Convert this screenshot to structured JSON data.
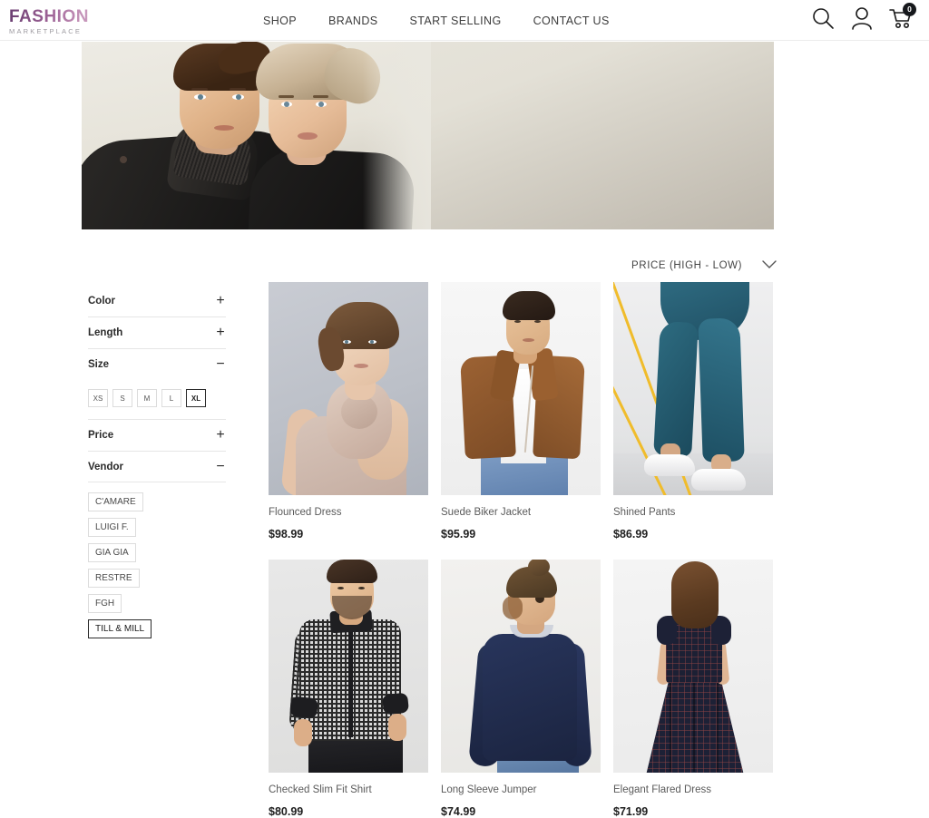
{
  "header": {
    "logo": {
      "main": "FASHION",
      "sub": "MARKETPLACE"
    },
    "nav": [
      {
        "label": "SHOP"
      },
      {
        "label": "BRANDS"
      },
      {
        "label": "START SELLING"
      },
      {
        "label": "CONTACT US"
      }
    ],
    "icons": {
      "search": "search-icon",
      "account": "user-icon",
      "cart": "cart-icon"
    },
    "cart_count": "0"
  },
  "hero": {
    "alt": "Two fashion models in black knitwear on beige backdrop"
  },
  "sort": {
    "label": "PRICE (HIGH - LOW)",
    "caret": "chevron-down-icon"
  },
  "filters": [
    {
      "id": "color",
      "title": "Color",
      "sign": "+",
      "expanded": false
    },
    {
      "id": "length",
      "title": "Length",
      "sign": "+",
      "expanded": false
    },
    {
      "id": "size",
      "title": "Size",
      "sign": "−",
      "expanded": true
    },
    {
      "id": "price",
      "title": "Price",
      "sign": "+",
      "expanded": false
    },
    {
      "id": "vendor",
      "title": "Vendor",
      "sign": "−",
      "expanded": true
    }
  ],
  "sizes": [
    {
      "label": "XS",
      "selected": false
    },
    {
      "label": "S",
      "selected": false
    },
    {
      "label": "M",
      "selected": false
    },
    {
      "label": "L",
      "selected": false
    },
    {
      "label": "XL",
      "selected": true
    }
  ],
  "vendors": [
    {
      "label": "C'AMARE",
      "selected": false
    },
    {
      "label": "LUIGI F.",
      "selected": false
    },
    {
      "label": "GIA GIA",
      "selected": false
    },
    {
      "label": "RESTRE",
      "selected": false
    },
    {
      "label": "FGH",
      "selected": false
    },
    {
      "label": "TILL & MILL",
      "selected": true
    }
  ],
  "products": [
    {
      "title": "Flounced Dress",
      "price": "$98.99",
      "art": "p1"
    },
    {
      "title": "Suede Biker Jacket",
      "price": "$95.99",
      "art": "p2"
    },
    {
      "title": "Shined Pants",
      "price": "$86.99",
      "art": "p3"
    },
    {
      "title": "Checked Slim Fit Shirt",
      "price": "$80.99",
      "art": "p4"
    },
    {
      "title": "Long Sleeve Jumper",
      "price": "$74.99",
      "art": "p5"
    },
    {
      "title": "Elegant Flared Dress",
      "price": "$71.99",
      "art": "p6"
    }
  ],
  "colors": {
    "logo_dark": "#6b3f72",
    "logo_light": "#d9b3cd",
    "text": "#3c3c3c",
    "muted": "#5a5a5a",
    "border": "#dcdcdc",
    "selected_border": "#2b2b2b",
    "badge_bg": "#16181c"
  }
}
